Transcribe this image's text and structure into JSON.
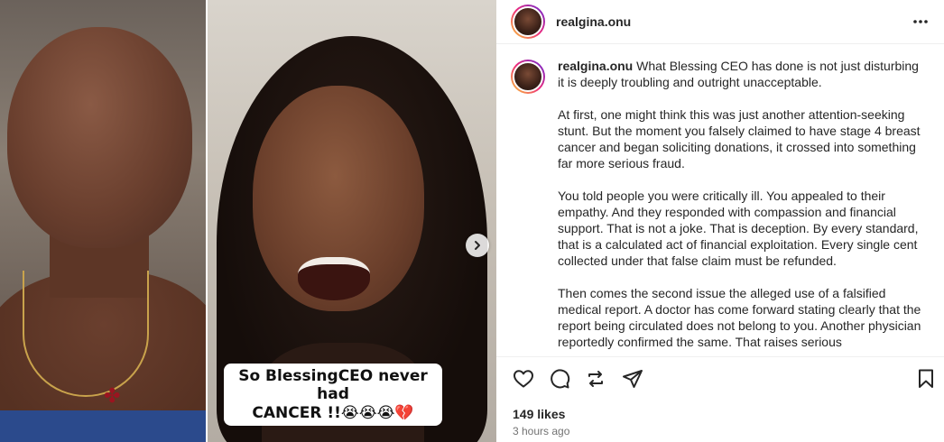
{
  "post": {
    "username": "realgina.onu",
    "media": {
      "caption_line1": "So BlessingCEO never had",
      "caption_line2": "CANCER !!😭😭😭💔"
    },
    "caption": {
      "username": "realgina.onu",
      "paragraphs": [
        " What Blessing CEO has done is not just disturbing it is deeply troubling and outright unacceptable.",
        "At first, one might think this was just another attention-seeking stunt. But the moment you falsely claimed to have stage 4 breast cancer and began soliciting donations, it crossed into something far more serious fraud.",
        "You told people you were critically ill. You appealed to their empathy. And they responded with compassion and financial support. That is not a joke. That is deception. By every standard, that is a calculated act of financial exploitation. Every single cent collected under that false claim must be refunded.",
        "Then comes the second issue the alleged use of a falsified medical report. A doctor has come forward stating clearly that the report being circulated does not belong to you. Another physician reportedly confirmed the same. That raises serious"
      ]
    },
    "likes": "149 likes",
    "time": "3 hours ago"
  },
  "icons": {
    "more": "more-options-icon",
    "like": "heart-icon",
    "comment": "comment-icon",
    "share": "share-icon",
    "send": "send-icon",
    "save": "bookmark-icon",
    "next": "chevron-right-icon"
  }
}
